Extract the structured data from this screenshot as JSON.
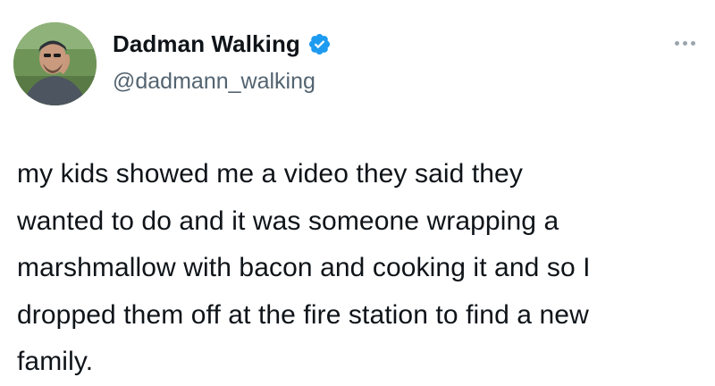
{
  "author": {
    "display_name": "Dadman Walking",
    "handle": "@dadmann_walking",
    "verified": true,
    "verified_color": "#1d9bf0"
  },
  "tweet": {
    "lines": [
      "my kids showed me a video they said they",
      "wanted to do and it was someone wrapping a",
      "marshmallow with bacon and cooking it and so I",
      "dropped them off at the fire station to find a new",
      "family."
    ]
  },
  "icons": {
    "more": "more-options-icon",
    "verified": "verified-badge-icon",
    "avatar": "avatar"
  },
  "colors": {
    "text": "#0f1419",
    "secondary": "#536471",
    "background": "#ffffff"
  }
}
